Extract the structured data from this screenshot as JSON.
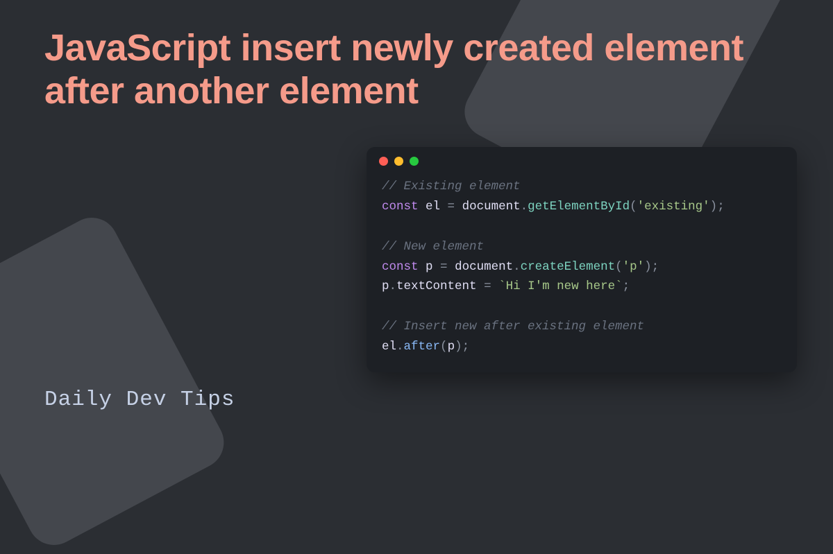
{
  "title": "JavaScript insert newly created element after another element",
  "footer": "Daily Dev Tips",
  "code": {
    "c1": "// Existing element",
    "kw_const": "const",
    "v_el": "el",
    "op_eq": " = ",
    "obj_doc": "document",
    "dot": ".",
    "m_get": "getElementById",
    "paren_o": "(",
    "s_existing": "'existing'",
    "paren_c": ")",
    "semi": ";",
    "c2": "// New element",
    "v_p": "p",
    "m_create": "createElement",
    "s_p": "'p'",
    "prop_tc": "textContent",
    "s_hi": "`Hi I'm new here`",
    "c3": "// Insert new after existing element",
    "m_after": "after"
  }
}
